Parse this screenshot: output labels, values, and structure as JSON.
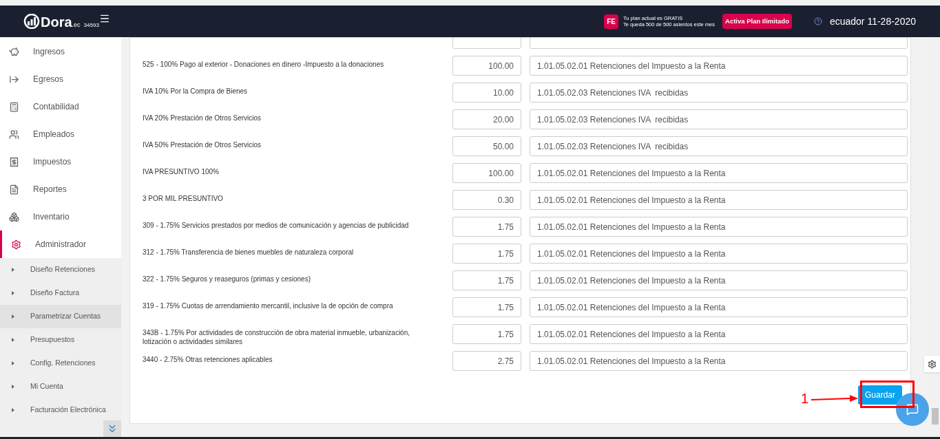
{
  "header": {
    "logo": {
      "name": "Dora",
      "suffix": ".ec",
      "number": "34593"
    },
    "plan_badge": "FE",
    "plan_lines": [
      "Tu plan actual es GRATIS",
      "Te queda 500 de 500 asientos este mes"
    ],
    "upgrade_button": "Activa Plan Ilimitado",
    "location_date": "ecuador 11-28-2020"
  },
  "sidebar": {
    "items": [
      {
        "label": "Ingresos",
        "selected": false
      },
      {
        "label": "Egresos",
        "selected": false
      },
      {
        "label": "Contabilidad",
        "selected": false
      },
      {
        "label": "Empleados",
        "selected": false
      },
      {
        "label": "Impuestos",
        "selected": false
      },
      {
        "label": "Reportes",
        "selected": false
      },
      {
        "label": "Inventario",
        "selected": false
      },
      {
        "label": "Administrador",
        "selected": true
      }
    ],
    "subitems": [
      {
        "label": "Diseño Retenciones",
        "selected": false
      },
      {
        "label": "Diseño Factura",
        "selected": false
      },
      {
        "label": "Parametrizar Cuentas",
        "selected": true
      },
      {
        "label": "Presupuestos",
        "selected": false
      },
      {
        "label": "Config. Retenciones",
        "selected": false
      },
      {
        "label": "Mi Cuenta",
        "selected": false
      },
      {
        "label": "Facturación Electrónica",
        "selected": false
      }
    ]
  },
  "rows": [
    {
      "label": "525 - 100% Pago al exterior - Donaciones en dinero -Impuesto a la donaciones",
      "value": "100.00",
      "account": "1.01.05.02.01 Retenciones del Impuesto a la Renta"
    },
    {
      "label": "IVA 10% Por la Compra de Bienes",
      "value": "10.00",
      "account": "1.01.05.02.03 Retenciones IVA  recibidas"
    },
    {
      "label": "IVA 20% Prestación de Otros Servicios",
      "value": "20.00",
      "account": "1.01.05.02.03 Retenciones IVA  recibidas"
    },
    {
      "label": "IVA 50% Prestación de Otros Servicios",
      "value": "50.00",
      "account": "1.01.05.02.03 Retenciones IVA  recibidas"
    },
    {
      "label": "IVA PRESUNTIVO 100%",
      "value": "100.00",
      "account": "1.01.05.02.01 Retenciones del Impuesto a la Renta"
    },
    {
      "label": "3 POR MIL PRESUNTIVO",
      "value": "0.30",
      "account": "1.01.05.02.01 Retenciones del Impuesto a la Renta"
    },
    {
      "label": "309 - 1.75% Servicios prestados por medios de comunicación y agencias de publicidad",
      "value": "1.75",
      "account": "1.01.05.02.01 Retenciones del Impuesto a la Renta"
    },
    {
      "label": "312 - 1.75% Transferencia de bienes muebles de naturaleza corporal",
      "value": "1.75",
      "account": "1.01.05.02.01 Retenciones del Impuesto a la Renta"
    },
    {
      "label": "322 - 1.75% Seguros y reaseguros (primas y cesiones)",
      "value": "1.75",
      "account": "1.01.05.02.01 Retenciones del Impuesto a la Renta"
    },
    {
      "label": "319 - 1.75% Cuotas de arrendamiento mercantil, inclusive la de opción de compra",
      "value": "1.75",
      "account": "1.01.05.02.01 Retenciones del Impuesto a la Renta"
    },
    {
      "label": "343B - 1.75% Por actividades de construcción de obra material inmueble, urbanización, lotización o actividades similares",
      "value": "1.75",
      "account": "1.01.05.02.01 Retenciones del Impuesto a la Renta"
    },
    {
      "label": "3440 - 2.75% Otras retenciones aplicables",
      "value": "2.75",
      "account": "1.01.05.02.01 Retenciones del Impuesto a la Renta"
    }
  ],
  "save_button": "Guardar",
  "annotation": "1"
}
